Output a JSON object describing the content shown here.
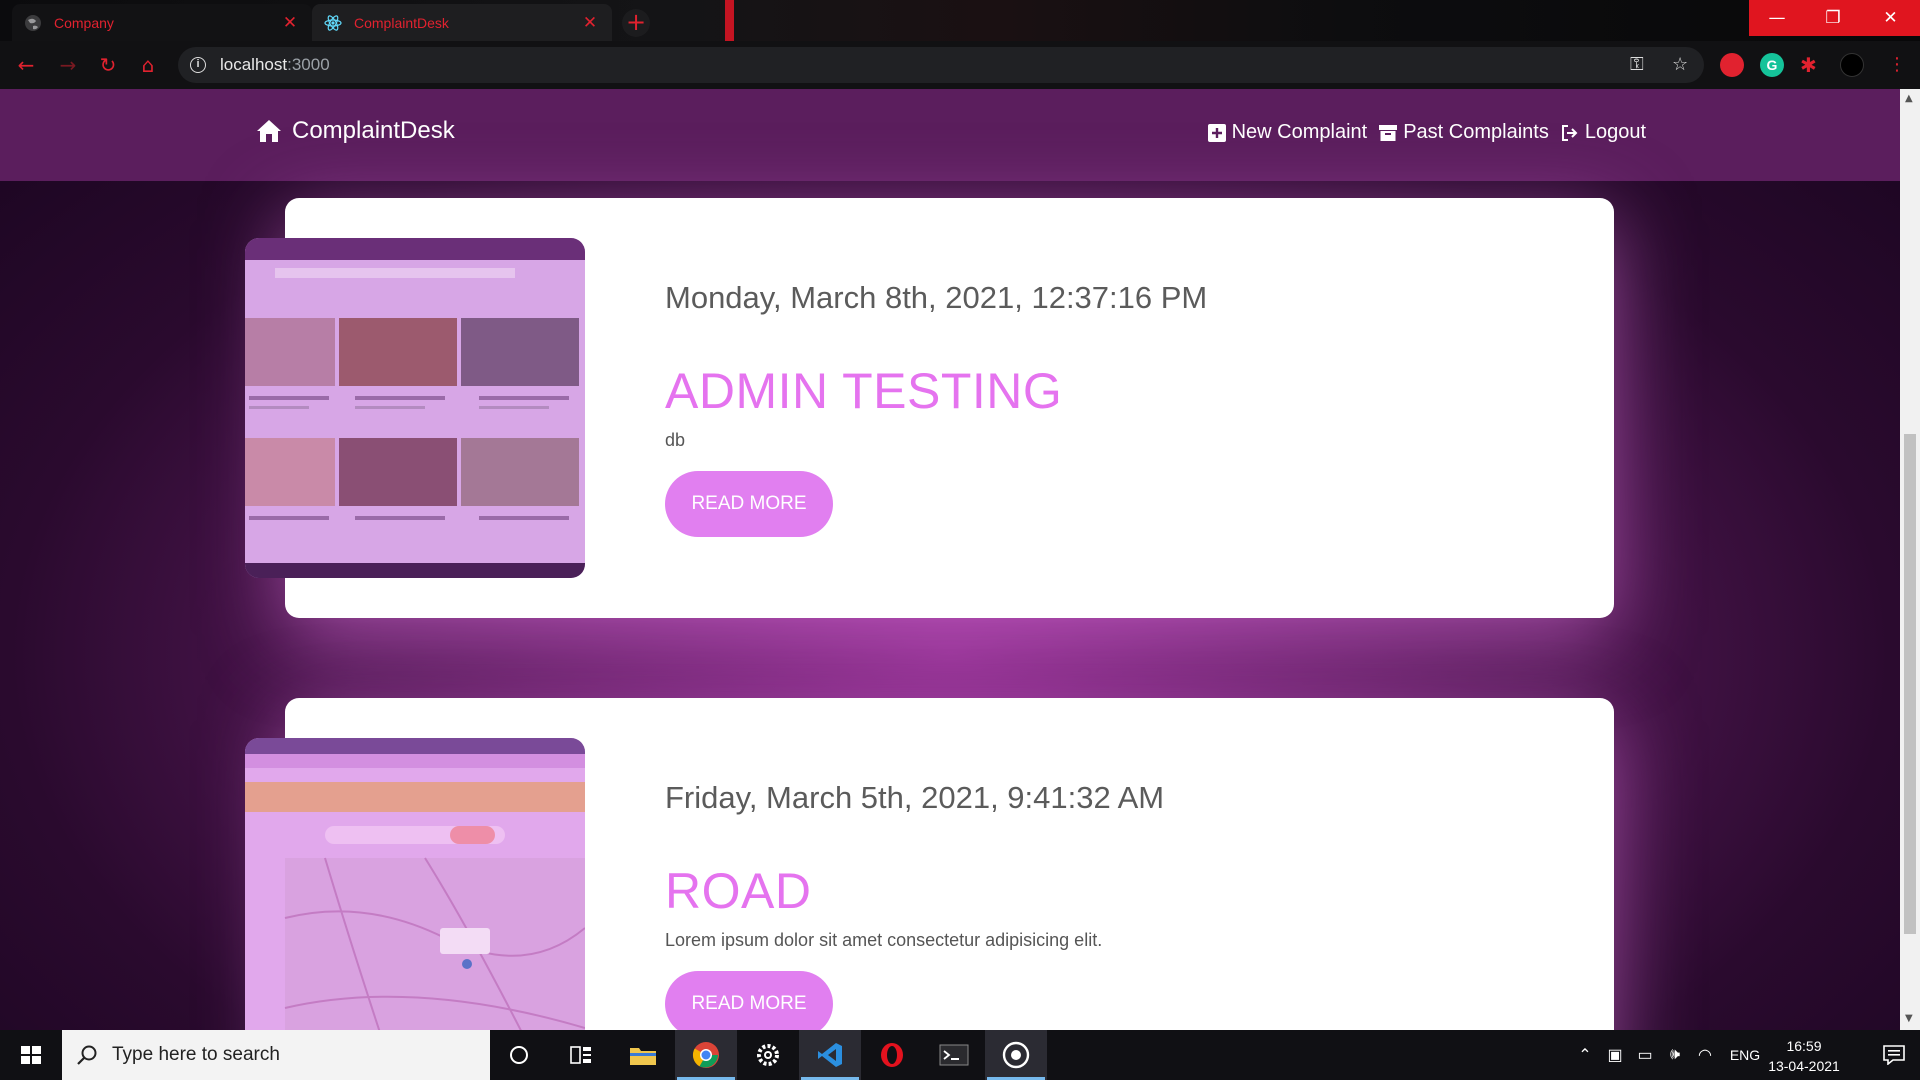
{
  "browser": {
    "tabs": [
      {
        "title": "Company",
        "active": false
      },
      {
        "title": "ComplaintDesk",
        "active": true
      }
    ],
    "url_host": "localhost",
    "url_port": ":3000",
    "accent_color": "#e1222f"
  },
  "app": {
    "brand": "ComplaintDesk",
    "nav": {
      "new_complaint": "New Complaint",
      "past_complaints": "Past Complaints",
      "logout": "Logout"
    },
    "accent_color": "#e573ef",
    "complaints": [
      {
        "date": "Monday, March 8th, 2021, 12:37:16 PM",
        "title": "ADMIN TESTING",
        "description": "db",
        "button": "READ MORE",
        "image": "screenshot-thumbnail"
      },
      {
        "date": "Friday, March 5th, 2021, 9:41:32 AM",
        "title": "ROAD",
        "description": "Lorem ipsum dolor sit amet consectetur adipisicing elit.",
        "button": "READ MORE",
        "image": "map-thumbnail"
      }
    ]
  },
  "taskbar": {
    "search_placeholder": "Type here to search",
    "language": "ENG",
    "time": "16:59",
    "date": "13-04-2021"
  }
}
